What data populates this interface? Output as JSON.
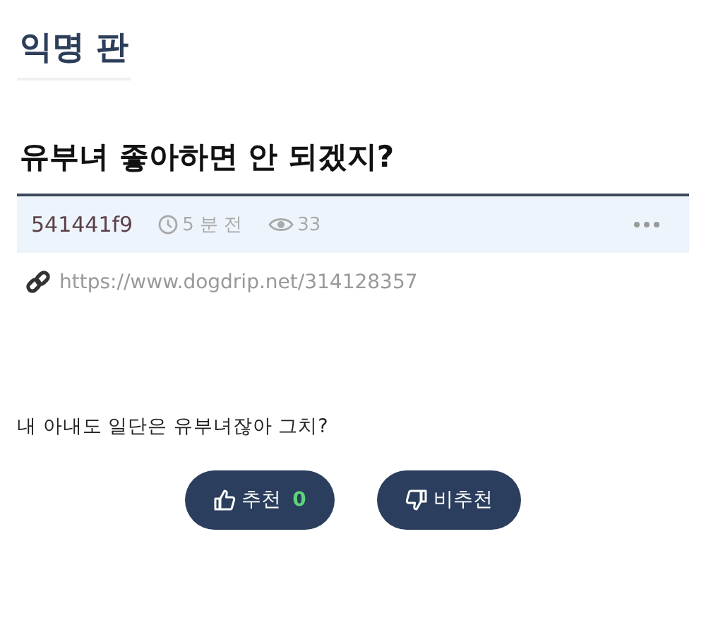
{
  "board": {
    "title": "익명 판"
  },
  "post": {
    "title": "유부녀 좋아하면 안 되겠지?",
    "author": "541441f9",
    "time": "5 분 전",
    "views": "33",
    "link": "https://www.dogdrip.net/314128357",
    "body": "내 아내도 일단은 유부녀잖아 그치?"
  },
  "votes": [
    {
      "kind": "up",
      "label": "추천",
      "count": "0"
    },
    {
      "kind": "down",
      "label": "비추천"
    }
  ]
}
